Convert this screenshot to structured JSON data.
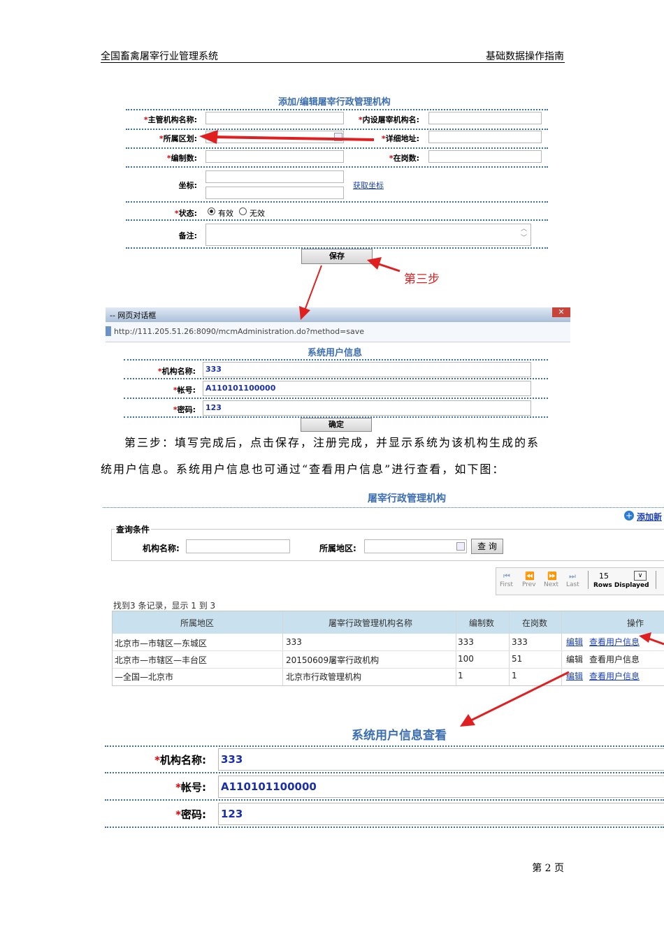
{
  "header": {
    "left": "全国畜禽屠宰行业管理系统",
    "right": "基础数据操作指南"
  },
  "form": {
    "title": "添加/编辑屠宰行政管理机构",
    "labels": {
      "org_name": "主管机构名称:",
      "inner_name": "内设屠宰机构名:",
      "region": "所属区划:",
      "address": "详细地址:",
      "staff_count": "编制数:",
      "on_duty": "在岗数:",
      "coords": "坐标:",
      "status": "状态:",
      "remark": "备注:"
    },
    "get_coords_link": "获取坐标",
    "status_options": [
      "有效",
      "无效"
    ],
    "save_button": "保存"
  },
  "annotation_step3": "第三步",
  "dialog": {
    "title": "-- 网页对话框",
    "url": "http://111.205.51.26:8090/mcmAdministration.do?method=save",
    "heading": "系统用户信息",
    "labels": {
      "org": "机构名称:",
      "account": "帐号:",
      "password": "密码:"
    },
    "values": {
      "org": "333",
      "account": "A110101100000",
      "password": "123"
    },
    "ok_button": "确定"
  },
  "paragraph": {
    "line1": "第三步：填写完成后，点击保存，注册完成，并显示系统为该机构生成的系",
    "line2": "统用户信息。系统用户信息也可通过“查看用户信息”进行查看，如下图："
  },
  "list_panel": {
    "title": "屠宰行政管理机构",
    "add_link": "添加新",
    "query_section": "查询条件",
    "query_labels": {
      "name": "机构名称:",
      "region": "所属地区:"
    },
    "query_button": "查 询",
    "pager": {
      "first": "First",
      "prev": "Prev",
      "next": "Next",
      "last": "Last",
      "rows": "15",
      "rows_label": "Rows Displayed"
    },
    "record_info": "找到3 条记录，显示 1 到 3",
    "columns": [
      "所属地区",
      "屠宰行政管理机构名称",
      "编制数",
      "在岗数",
      "操作"
    ],
    "rows": [
      {
        "region": "北京市—市辖区—东城区",
        "name": "333",
        "staff": "333",
        "duty": "333",
        "edit": "编辑",
        "view": "查看用户信息"
      },
      {
        "region": "北京市—市辖区—丰台区",
        "name": "20150609屠宰行政机构",
        "staff": "100",
        "duty": "51",
        "edit": "编辑",
        "view": "查看用户信息"
      },
      {
        "region": "—全国—北京市",
        "name": "北京市行政管理机构",
        "staff": "1",
        "duty": "1",
        "edit": "编辑",
        "view": "查看用户信息"
      }
    ]
  },
  "view_panel": {
    "title": "系统用户信息查看",
    "labels": {
      "org": "机构名称:",
      "account": "帐号:",
      "password": "密码:"
    },
    "values": {
      "org": "333",
      "account": "A110101100000",
      "password": "123"
    }
  },
  "footer": {
    "page": "第 2 页"
  },
  "colors": {
    "accent_blue": "#3b6eb0",
    "arrow_red": "#e02020",
    "table_header": "#c9e1ee"
  }
}
